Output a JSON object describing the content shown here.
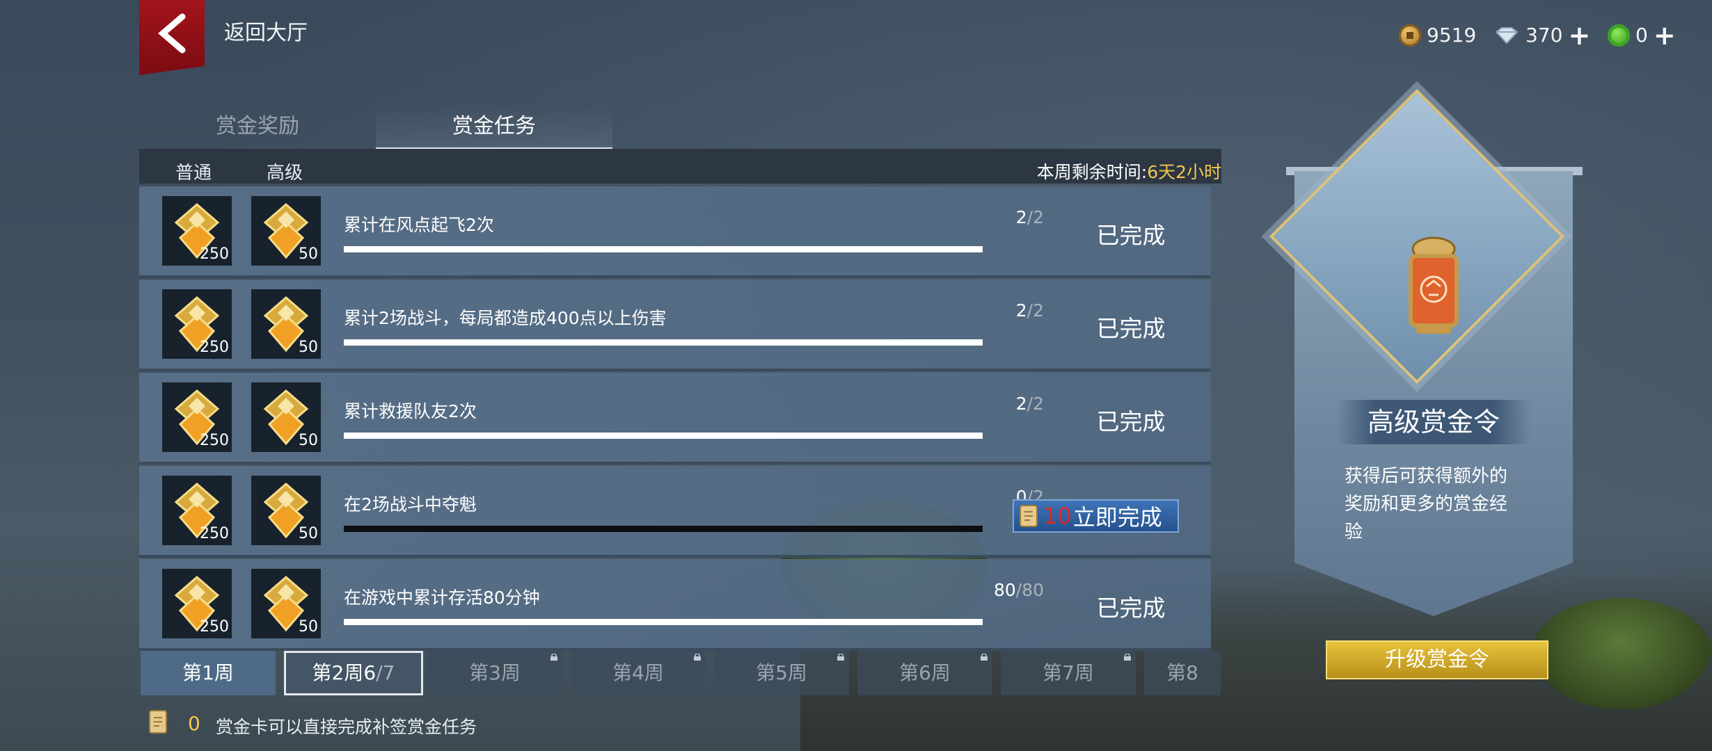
{
  "header": {
    "back_label": "返回大厅"
  },
  "currencies": [
    {
      "icon": "copper-coin-icon",
      "value": "9519"
    },
    {
      "icon": "diamond-icon",
      "value": "370"
    },
    {
      "icon": "jade-coin-icon",
      "value": "0"
    }
  ],
  "tabs": {
    "reward": "赏金奖励",
    "task": "赏金任务"
  },
  "columns": {
    "normal": "普通",
    "advanced": "高级"
  },
  "remaining": {
    "label": "本周剩余时间:",
    "value": "6天2小时"
  },
  "tasks": [
    {
      "desc": "累计在风点起飞2次",
      "done": "2",
      "total": "/2",
      "normal_qty": "250",
      "adv_qty": "50",
      "progress": 1.0,
      "status": "已完成"
    },
    {
      "desc": "累计2场战斗，每局都造成400点以上伤害",
      "done": "2",
      "total": "/2",
      "normal_qty": "250",
      "adv_qty": "50",
      "progress": 1.0,
      "status": "已完成"
    },
    {
      "desc": "累计救援队友2次",
      "done": "2",
      "total": "/2",
      "normal_qty": "250",
      "adv_qty": "50",
      "progress": 1.0,
      "status": "已完成"
    },
    {
      "desc": "在2场战斗中夺魁",
      "done": "0",
      "total": "/2",
      "normal_qty": "250",
      "adv_qty": "50",
      "progress": 0.0,
      "button_cost": "10",
      "button_label": "立即完成"
    },
    {
      "desc": "在游戏中累计存活80分钟",
      "done": "80",
      "total": "/80",
      "normal_qty": "250",
      "adv_qty": "50",
      "progress": 1.0,
      "status": "已完成"
    }
  ],
  "weeks": [
    {
      "label": "第1周"
    },
    {
      "label": "第2周",
      "done": "6",
      "total": "/7"
    },
    {
      "label": "第3周",
      "locked": true
    },
    {
      "label": "第4周",
      "locked": true
    },
    {
      "label": "第5周",
      "locked": true
    },
    {
      "label": "第6周",
      "locked": true
    },
    {
      "label": "第7周",
      "locked": true
    },
    {
      "label": "第8"
    }
  ],
  "footer": {
    "card_count": "0",
    "text": "赏金卡可以直接完成补签赏金任务"
  },
  "banner": {
    "title": "高级赏金令",
    "desc": "获得后可获得额外的奖励和更多的赏金经验",
    "button": "升级赏金令"
  },
  "colors": {
    "accent_gold": "#f2c84b",
    "cost_red": "#d92a2a",
    "flag_red": "#a3141c",
    "button_blue": "#3f74b7"
  }
}
